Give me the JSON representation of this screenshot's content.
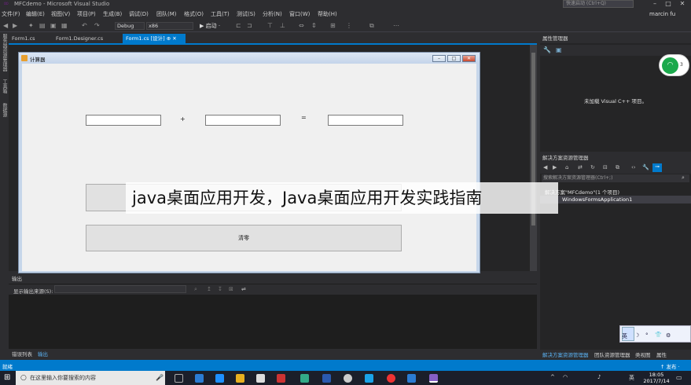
{
  "window": {
    "title": "MFCdemo - Microsoft Visual Studio",
    "quick_launch": "快速启动 (Ctrl+Q)",
    "user": "marcin fu"
  },
  "menu": [
    "文件(F)",
    "编辑(E)",
    "视图(V)",
    "项目(P)",
    "生成(B)",
    "调试(D)",
    "团队(M)",
    "格式(O)",
    "工具(T)",
    "测试(S)",
    "分析(N)",
    "窗口(W)",
    "帮助(H)"
  ],
  "toolbar": {
    "config": "Debug",
    "platform": "x86",
    "start": "▶ 启动 ·"
  },
  "left_strip": [
    "服务器资源管理器",
    "工具箱",
    "数据源"
  ],
  "doc_tabs": [
    "Form1.cs",
    "Form1.Designer.cs",
    "Form1.cs [设计]"
  ],
  "form": {
    "title": "计算器",
    "plus": "+",
    "equals": "=",
    "clear_button": "清零"
  },
  "properties": {
    "header": "属性管理器",
    "message": "未加载 Visual C++ 项目。"
  },
  "solution": {
    "header": "解决方案资源管理器",
    "search": "搜索解决方案资源管理器(Ctrl+;)",
    "item1": "解决方案\"MFCdemo\"(1 个项目)",
    "item2": "WindowsFormsApplication1",
    "tabs": [
      "解决方案资源管理器",
      "团队资源管理器",
      "类视图",
      "属性"
    ]
  },
  "output": {
    "header": "输出",
    "source_label": "显示输出来源(S):",
    "tabs": [
      "错误列表",
      "输出"
    ]
  },
  "status": {
    "left": "就绪",
    "right": "↑ 发布 ·"
  },
  "taskbar": {
    "search": "在这里输入你要搜索的内容",
    "time": "18:05",
    "date": "2017/7/14"
  },
  "ime": {
    "lang": "英",
    "moon": "☽",
    "dot": "°",
    "shirt": "👕",
    "gear": "⚙"
  },
  "badge": {
    "num": "3"
  },
  "watermark": "java桌面应用开发，Java桌面应用开发实践指南"
}
